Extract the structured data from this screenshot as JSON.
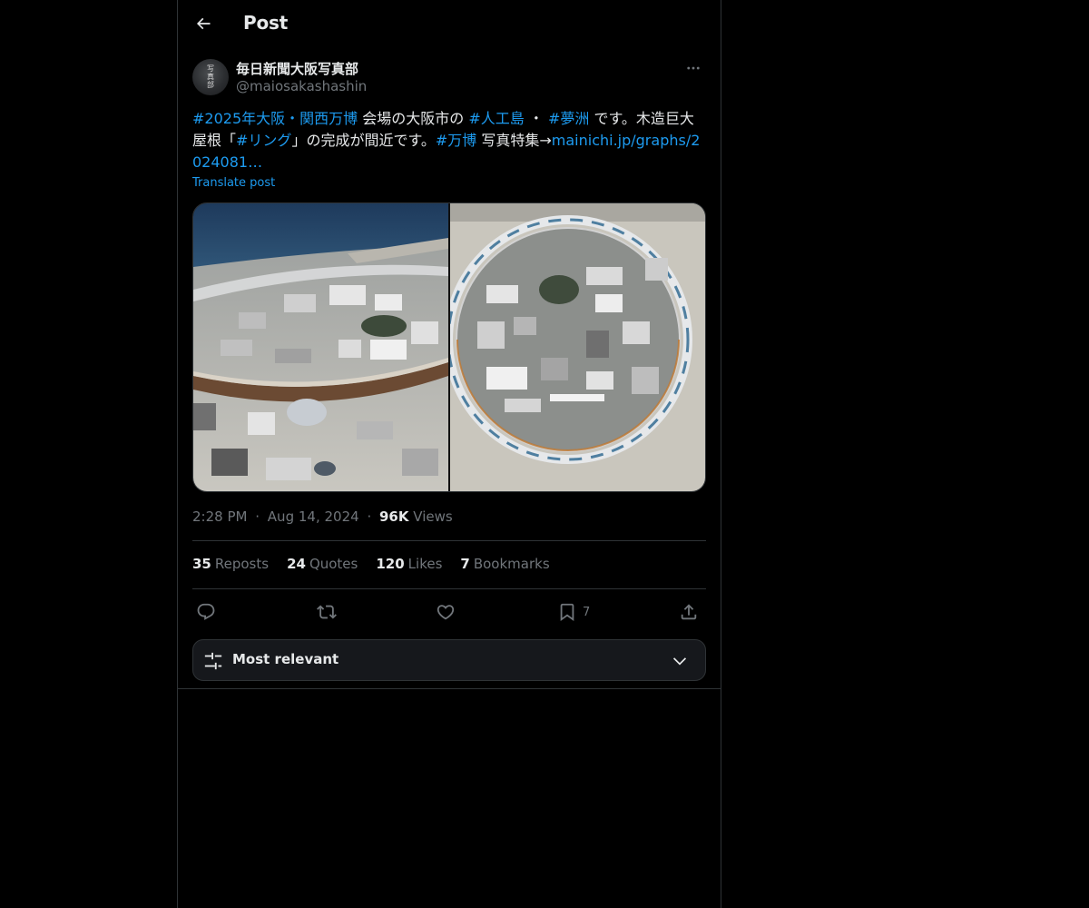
{
  "header": {
    "title": "Post",
    "back_icon": "arrow-left-icon"
  },
  "author": {
    "display_name": "毎日新聞大阪写真部",
    "handle": "@maiosakashashin",
    "avatar_seal": "写真部",
    "more_icon": "more-horizontal-icon"
  },
  "tweet": {
    "segments": [
      {
        "type": "tag",
        "text": "#2025年大阪・関西万博"
      },
      {
        "type": "text",
        "text": " 会場の大阪市の "
      },
      {
        "type": "tag",
        "text": "#人工島"
      },
      {
        "type": "text",
        "text": " ・ "
      },
      {
        "type": "tag",
        "text": "#夢洲"
      },
      {
        "type": "text",
        "text": " です。木造巨大屋根「"
      },
      {
        "type": "tag",
        "text": "#リング"
      },
      {
        "type": "text",
        "text": "」の完成が間近です。"
      },
      {
        "type": "tag",
        "text": "#万博"
      },
      {
        "type": "text",
        "text": " 写真特集→"
      },
      {
        "type": "link",
        "text": "mainichi.jp/graphs/2024081…"
      }
    ],
    "translate_label": "Translate post"
  },
  "media": {
    "photos": [
      {
        "name": "photo-expo-site-oblique"
      },
      {
        "name": "photo-expo-ring-aerial"
      }
    ]
  },
  "meta": {
    "time": "2:28 PM",
    "separator": "·",
    "date": "Aug 14, 2024",
    "views_count": "96K",
    "views_label": "Views"
  },
  "stats": {
    "reposts": {
      "count": "35",
      "label": "Reposts"
    },
    "quotes": {
      "count": "24",
      "label": "Quotes"
    },
    "likes": {
      "count": "120",
      "label": "Likes"
    },
    "bookmarks": {
      "count": "7",
      "label": "Bookmarks"
    }
  },
  "actions": {
    "reply_icon": "reply-icon",
    "repost_icon": "repost-icon",
    "like_icon": "heart-icon",
    "bookmark_icon": "bookmark-icon",
    "bookmark_count": "7",
    "share_icon": "share-icon"
  },
  "sort": {
    "label": "Most relevant",
    "icon": "sliders-icon",
    "chevron": "chevron-down-icon"
  },
  "colors": {
    "background": "#000000",
    "text_primary": "#e7e9ea",
    "text_secondary": "#71767b",
    "accent": "#1d9bf0",
    "border": "#2f3336"
  }
}
